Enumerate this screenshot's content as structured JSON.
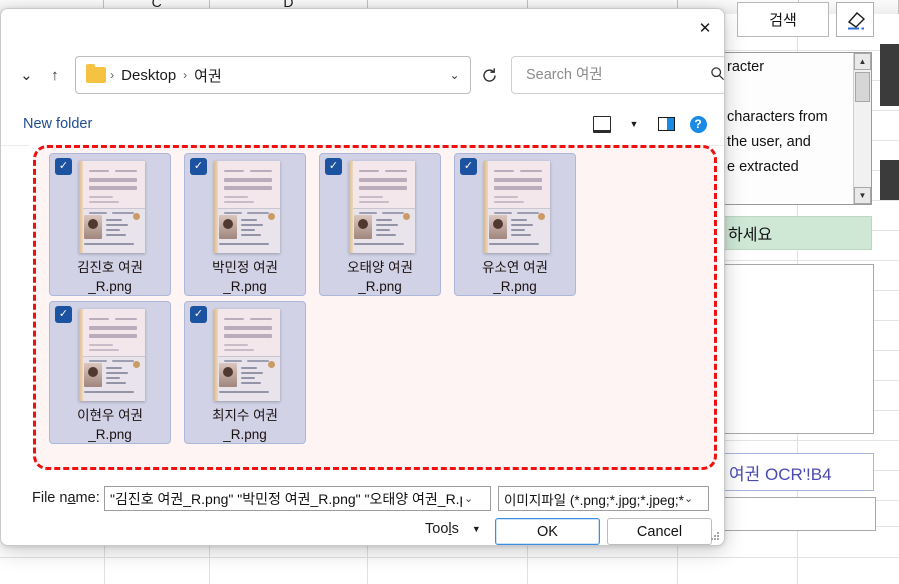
{
  "background": {
    "sheet_columns": [
      "C",
      "D"
    ],
    "partial_prompt_text": "택하세요.",
    "search_button_label": "검색",
    "eraser_icon": "eraser-icon",
    "textarea_lines": [
      "racter",
      "characters from",
      "the user, and",
      "e extracted"
    ],
    "green_field_text": "하세요",
    "blue_field_text": "여권 OCR'!B4"
  },
  "dialog": {
    "close_label": "✕",
    "nav": {
      "back_icon": "chevron-down-icon",
      "up_icon": "arrow-up-icon",
      "refresh_icon": "refresh-icon"
    },
    "address": {
      "folder_icon": "folder-icon",
      "crumbs": [
        "Desktop",
        "여권"
      ],
      "separator": "›",
      "dropdown_icon": "chevron-down-icon"
    },
    "search": {
      "placeholder": "Search 여권",
      "value": "",
      "icon": "search-icon"
    },
    "commandbar": {
      "new_folder_label": "New folder",
      "view_icon": "view-layout-icon",
      "view_caret": "▼",
      "preview_pane_icon": "preview-pane-icon",
      "help_icon": "help-icon",
      "help_glyph": "?"
    },
    "files": [
      {
        "name_line1": "김진호 여권",
        "name_line2": "_R.png",
        "selected": true
      },
      {
        "name_line1": "박민정 여권",
        "name_line2": "_R.png",
        "selected": true
      },
      {
        "name_line1": "오태양 여권",
        "name_line2": "_R.png",
        "selected": true
      },
      {
        "name_line1": "유소연 여권",
        "name_line2": "_R.png",
        "selected": true
      },
      {
        "name_line1": "이현우 여권",
        "name_line2": "_R.png",
        "selected": true
      },
      {
        "name_line1": "최지수 여권",
        "name_line2": "_R.png",
        "selected": true
      }
    ],
    "checkmark_glyph": "✓",
    "bottom": {
      "filename_label": "File name:",
      "filename_value": "\"김진호 여권_R.png\" \"박민정 여권_R.png\" \"오태양 여권_R.pn",
      "filename_chevron": "⌄",
      "filetype_value": "이미지파일 (*.png;*.jpg;*.jpeg;*.",
      "filetype_chevron": "⌄",
      "tools_label": "Tools",
      "tools_caret": "▼",
      "ok_label": "OK",
      "cancel_label": "Cancel"
    }
  },
  "annotation": {
    "color": "#ee1111",
    "style": "dashed-rounded-rectangle"
  },
  "colors": {
    "selection_bg": "#cfdcf1",
    "selection_border": "#a9c0e4",
    "checkbox": "#1257a8",
    "accent_blue": "#1b8ae5",
    "annotation_red": "#ee1111",
    "green_field": "#cfe8d6"
  }
}
